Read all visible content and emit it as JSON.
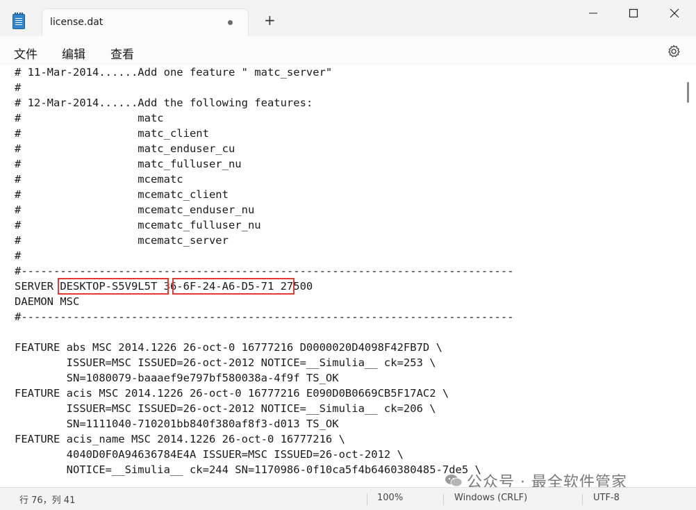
{
  "window": {
    "tab_title": "license.dat",
    "new_tab_symbol": "+"
  },
  "menu": {
    "items": [
      "文件",
      "编辑",
      "查看"
    ]
  },
  "editor": {
    "lines": [
      "# 11-Mar-2014......Add one feature \" matc_server\"",
      "#",
      "# 12-Mar-2014......Add the following features:",
      "#                  matc",
      "#                  matc_client",
      "#                  matc_enduser_cu",
      "#                  matc_fulluser_nu",
      "#                  mcematc",
      "#                  mcematc_client",
      "#                  mcematc_enduser_nu",
      "#                  mcematc_fulluser_nu",
      "#                  mcematc_server",
      "#",
      "#----------------------------------------------------------------------------",
      "SERVER DESKTOP-S5V9L5T 36-6F-24-A6-D5-71 27500",
      "DAEMON MSC",
      "#----------------------------------------------------------------------------",
      "",
      "FEATURE abs MSC 2014.1226 26-oct-0 16777216 D0000020D4098F42FB7D \\",
      "        ISSUER=MSC ISSUED=26-oct-2012 NOTICE=__Simulia__ ck=253 \\",
      "        SN=1080079-baaaef9e797bf580038a-4f9f TS_OK",
      "FEATURE acis MSC 2014.1226 26-oct-0 16777216 E090D0B0669CB5F17AC2 \\",
      "        ISSUER=MSC ISSUED=26-oct-2012 NOTICE=__Simulia__ ck=206 \\",
      "        SN=1111040-710201bb840f380af8f3-d013 TS_OK",
      "FEATURE acis_name MSC 2014.1226 26-oct-0 16777216 \\",
      "        4040D0F0A94636784E4A ISSUER=MSC ISSUED=26-oct-2012 \\",
      "        NOTICE=__Simulia__ ck=244 SN=1170986-0f10ca5f4b6460380485-7de5 \\"
    ],
    "highlights": [
      "DESKTOP-S5V9L5T",
      "36-6F-24-A6-D5-71"
    ]
  },
  "status": {
    "position": "行 76，列 41",
    "zoom": "100%",
    "line_ending": "Windows (CRLF)",
    "encoding": "UTF-8"
  },
  "watermark": {
    "text": "公众号 · 最全软件管家"
  }
}
